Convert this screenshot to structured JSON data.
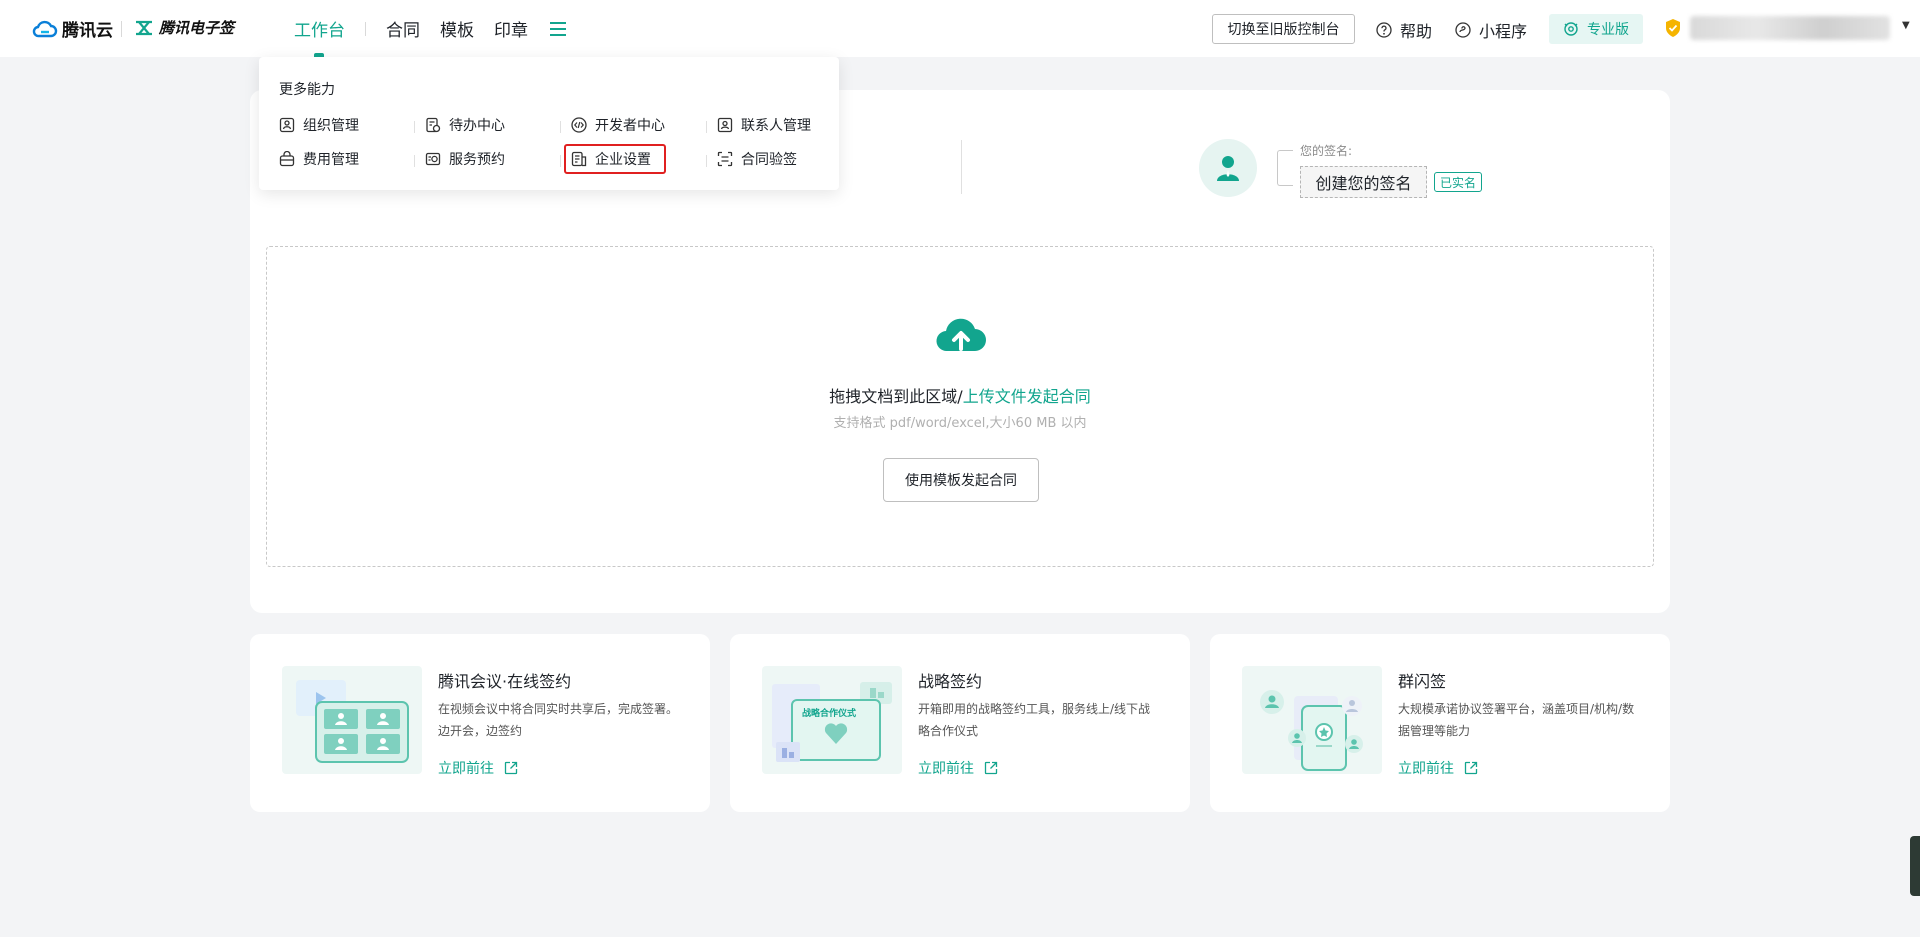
{
  "header": {
    "brand_cloud": "腾讯云",
    "brand_esign": "腾讯电子签",
    "nav": {
      "workbench": "工作台",
      "contract": "合同",
      "template": "模板",
      "seal": "印章"
    },
    "switch_old": "切换至旧版控制台",
    "help": "帮助",
    "mini_program": "小程序",
    "edition": "专业版"
  },
  "dropdown": {
    "title": "更多能力",
    "items": [
      "组织管理",
      "待办中心",
      "开发者中心",
      "联系人管理",
      "费用管理",
      "服务预约",
      "企业设置",
      "合同验签"
    ]
  },
  "signature": {
    "label": "您的签名:",
    "create": "创建您的签名",
    "verified": "已实名"
  },
  "upload": {
    "text_prefix": "拖拽文档到此区域/",
    "text_link": "上传文件发起合同",
    "hint": "支持格式 pdf/word/excel,大小60 MB 以内",
    "template_button": "使用模板发起合同"
  },
  "features": [
    {
      "title": "腾讯会议·在线签约",
      "desc": "在视频会议中将合同实时共享后，完成签署。边开会，边签约",
      "link": "立即前往"
    },
    {
      "title": "战略签约",
      "desc": "开箱即用的战略签约工具，服务线上/线下战略合作仪式",
      "link": "立即前往",
      "thumb_text": "战略合作仪式"
    },
    {
      "title": "群闪签",
      "desc": "大规模承诺协议签署平台，涵盖项目/机构/数据管理等能力",
      "link": "立即前往"
    }
  ],
  "colors": {
    "accent": "#12a58e",
    "highlight": "#e02020"
  }
}
